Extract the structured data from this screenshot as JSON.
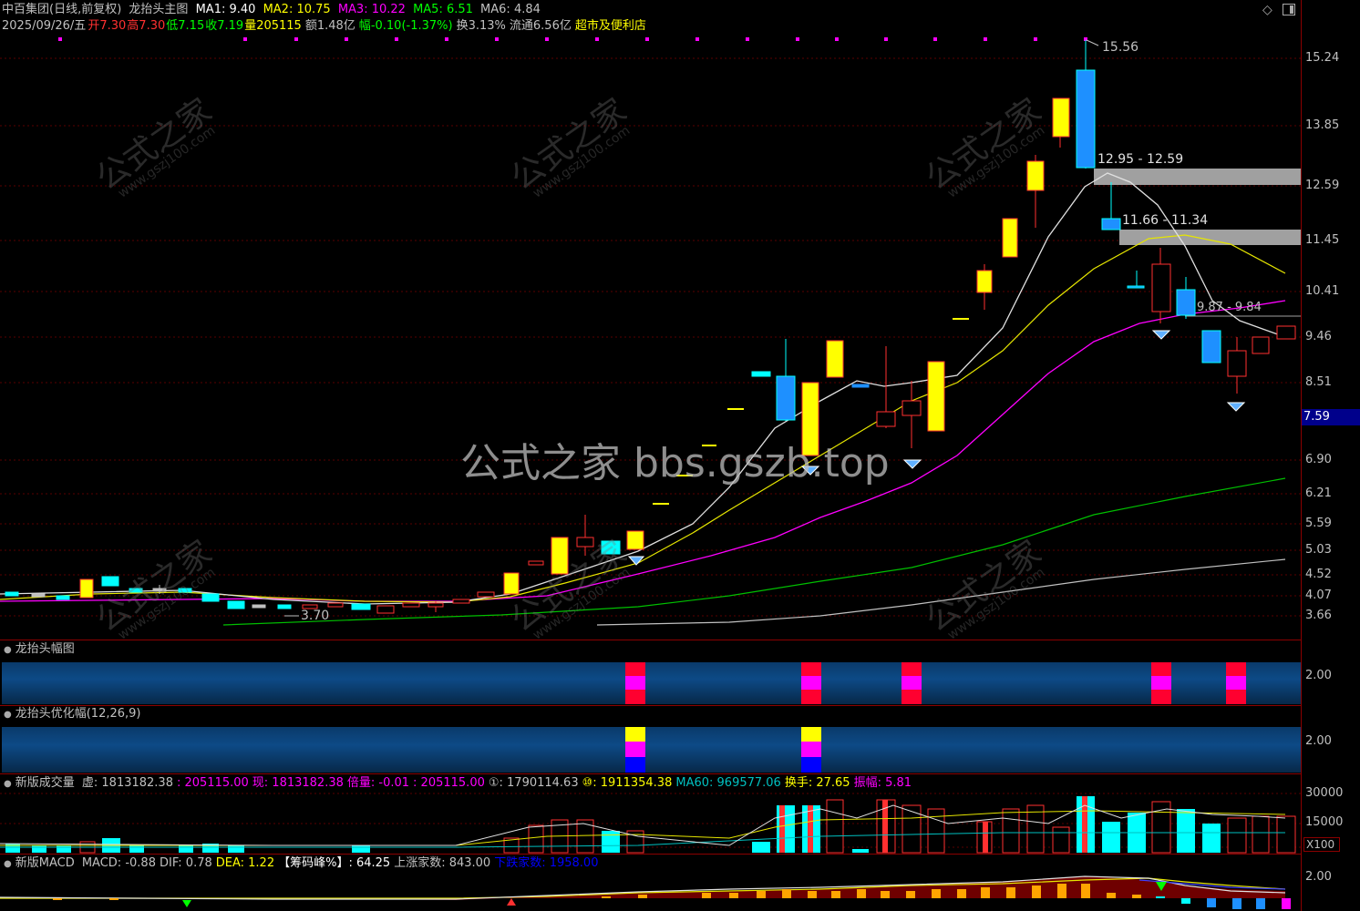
{
  "header": {
    "stock": "中百集团(日线,前复权)",
    "indicator": "龙抬头主图",
    "ma": [
      {
        "label": "MA1: 9.40",
        "color": "#ffffff"
      },
      {
        "label": "MA2: 10.75",
        "color": "#ffff00"
      },
      {
        "label": "MA3: 10.22",
        "color": "#ff00ff"
      },
      {
        "label": "MA5: 6.51",
        "color": "#00ff00"
      },
      {
        "label": "MA6: 4.84",
        "color": "#c0c0c0"
      }
    ]
  },
  "info": {
    "date": "2025/09/26/五",
    "open_label": "开",
    "open": "7.30",
    "high_label": "高",
    "high": "7.30",
    "low_label": "低",
    "low": "7.15",
    "close_label": "收",
    "close": "7.19",
    "vol_label": "量",
    "vol": "205115",
    "amount": "额1.48亿",
    "change_label": "幅",
    "change": "-0.10(-1.37%)",
    "turnover": "换3.13%",
    "float": "流通6.56亿",
    "sector": "超市及便利店"
  },
  "main_axis": {
    "ticks": [
      "15.24",
      "13.85",
      "12.59",
      "11.45",
      "10.41",
      "9.46",
      "8.51",
      "7.59",
      "6.90",
      "6.21",
      "5.59",
      "5.03",
      "4.52",
      "4.07",
      "3.66"
    ],
    "current": "7.59"
  },
  "annotations": {
    "high": "15.56",
    "low": "3.70",
    "zone1": "12.95 - 12.59",
    "zone2": "11.66 - 11.34",
    "zone3": "9.87 - 9.84"
  },
  "watermark": {
    "center": "公式之家 bbs.gszb.top",
    "cn": "公式之家",
    "url": "www.gszj100.com"
  },
  "panel1": {
    "title": "龙抬头幅图",
    "tick": "2.00"
  },
  "panel2": {
    "title": "龙抬头优化幅(12,26,9)",
    "tick": "2.00"
  },
  "panel3": {
    "title": "新版成交量",
    "items": [
      {
        "label": "虚: 1813182.38",
        "color": "#c0c0c0"
      },
      {
        "label": ": 205115.00",
        "color": "#ff00ff"
      },
      {
        "label": "现: 1813182.38",
        "color": "#ff00ff"
      },
      {
        "label": "倍量: -0.01",
        "color": "#ff00ff"
      },
      {
        "label": ": 205115.00",
        "color": "#ff00ff"
      },
      {
        "label": "①: 1790114.63",
        "color": "#c0c0c0"
      },
      {
        "label": "⑩: 1911354.38",
        "color": "#ffff00"
      },
      {
        "label": "MA60: 969577.06",
        "color": "#00c0c0"
      },
      {
        "label": "换手: 27.65",
        "color": "#ffff00"
      },
      {
        "label": "振幅: 5.81",
        "color": "#ff00ff"
      }
    ],
    "ticks": [
      "30000",
      "15000"
    ],
    "unit": "X100"
  },
  "panel4": {
    "title": "新版MACD",
    "items": [
      {
        "label": "MACD: -0.88",
        "color": "#c0c0c0"
      },
      {
        "label": "DIF: 0.78",
        "color": "#c0c0c0"
      },
      {
        "label": "DEA: 1.22",
        "color": "#ffff00"
      },
      {
        "label": "【筹码峰%】: 64.25",
        "color": "#ffffff"
      },
      {
        "label": "上涨家数: 843.00",
        "color": "#c0c0c0"
      },
      {
        "label": "下跌家数: 1958.00",
        "color": "#0000ff"
      }
    ],
    "tick": "2.00"
  },
  "colors": {
    "up": "#ff3030",
    "down": "#00ffff",
    "bull": "#ffff00",
    "bear": "#1e90ff"
  }
}
